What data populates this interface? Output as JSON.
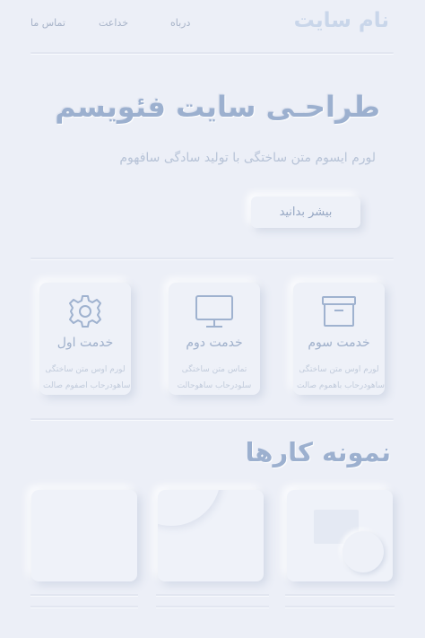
{
  "header": {
    "site_name": "نام سایت",
    "nav": [
      "درباه",
      "خداعت",
      "تماس ما"
    ]
  },
  "hero": {
    "title": "طراحـی سایت فئویسم",
    "subtitle": "لورم ایسوم متن ساختگی با تولید سادگی سافهوم",
    "button_label": "بیشر بدانید"
  },
  "services": [
    {
      "icon": "box-icon",
      "title": "خدمت سوم",
      "lines": [
        "لورم اوس متن ساختگی",
        "ساهودرحاب باهموم صالت"
      ]
    },
    {
      "icon": "monitor-icon",
      "title": "خدمت دوم",
      "lines": [
        "تماس متن ساختگی",
        "سلودرحاب ساهوحالت"
      ]
    },
    {
      "icon": "gear-icon",
      "title": "خدمت اول",
      "lines": [
        "لورم اوس متن ساختگی",
        "ساهودرحاب اصفوم صالت"
      ]
    }
  ],
  "portfolio": {
    "title": "نمونه کارها"
  },
  "colors": {
    "background": "#eceff7",
    "accent": "#9cb0cf",
    "muted_text": "#b7c3d7"
  }
}
